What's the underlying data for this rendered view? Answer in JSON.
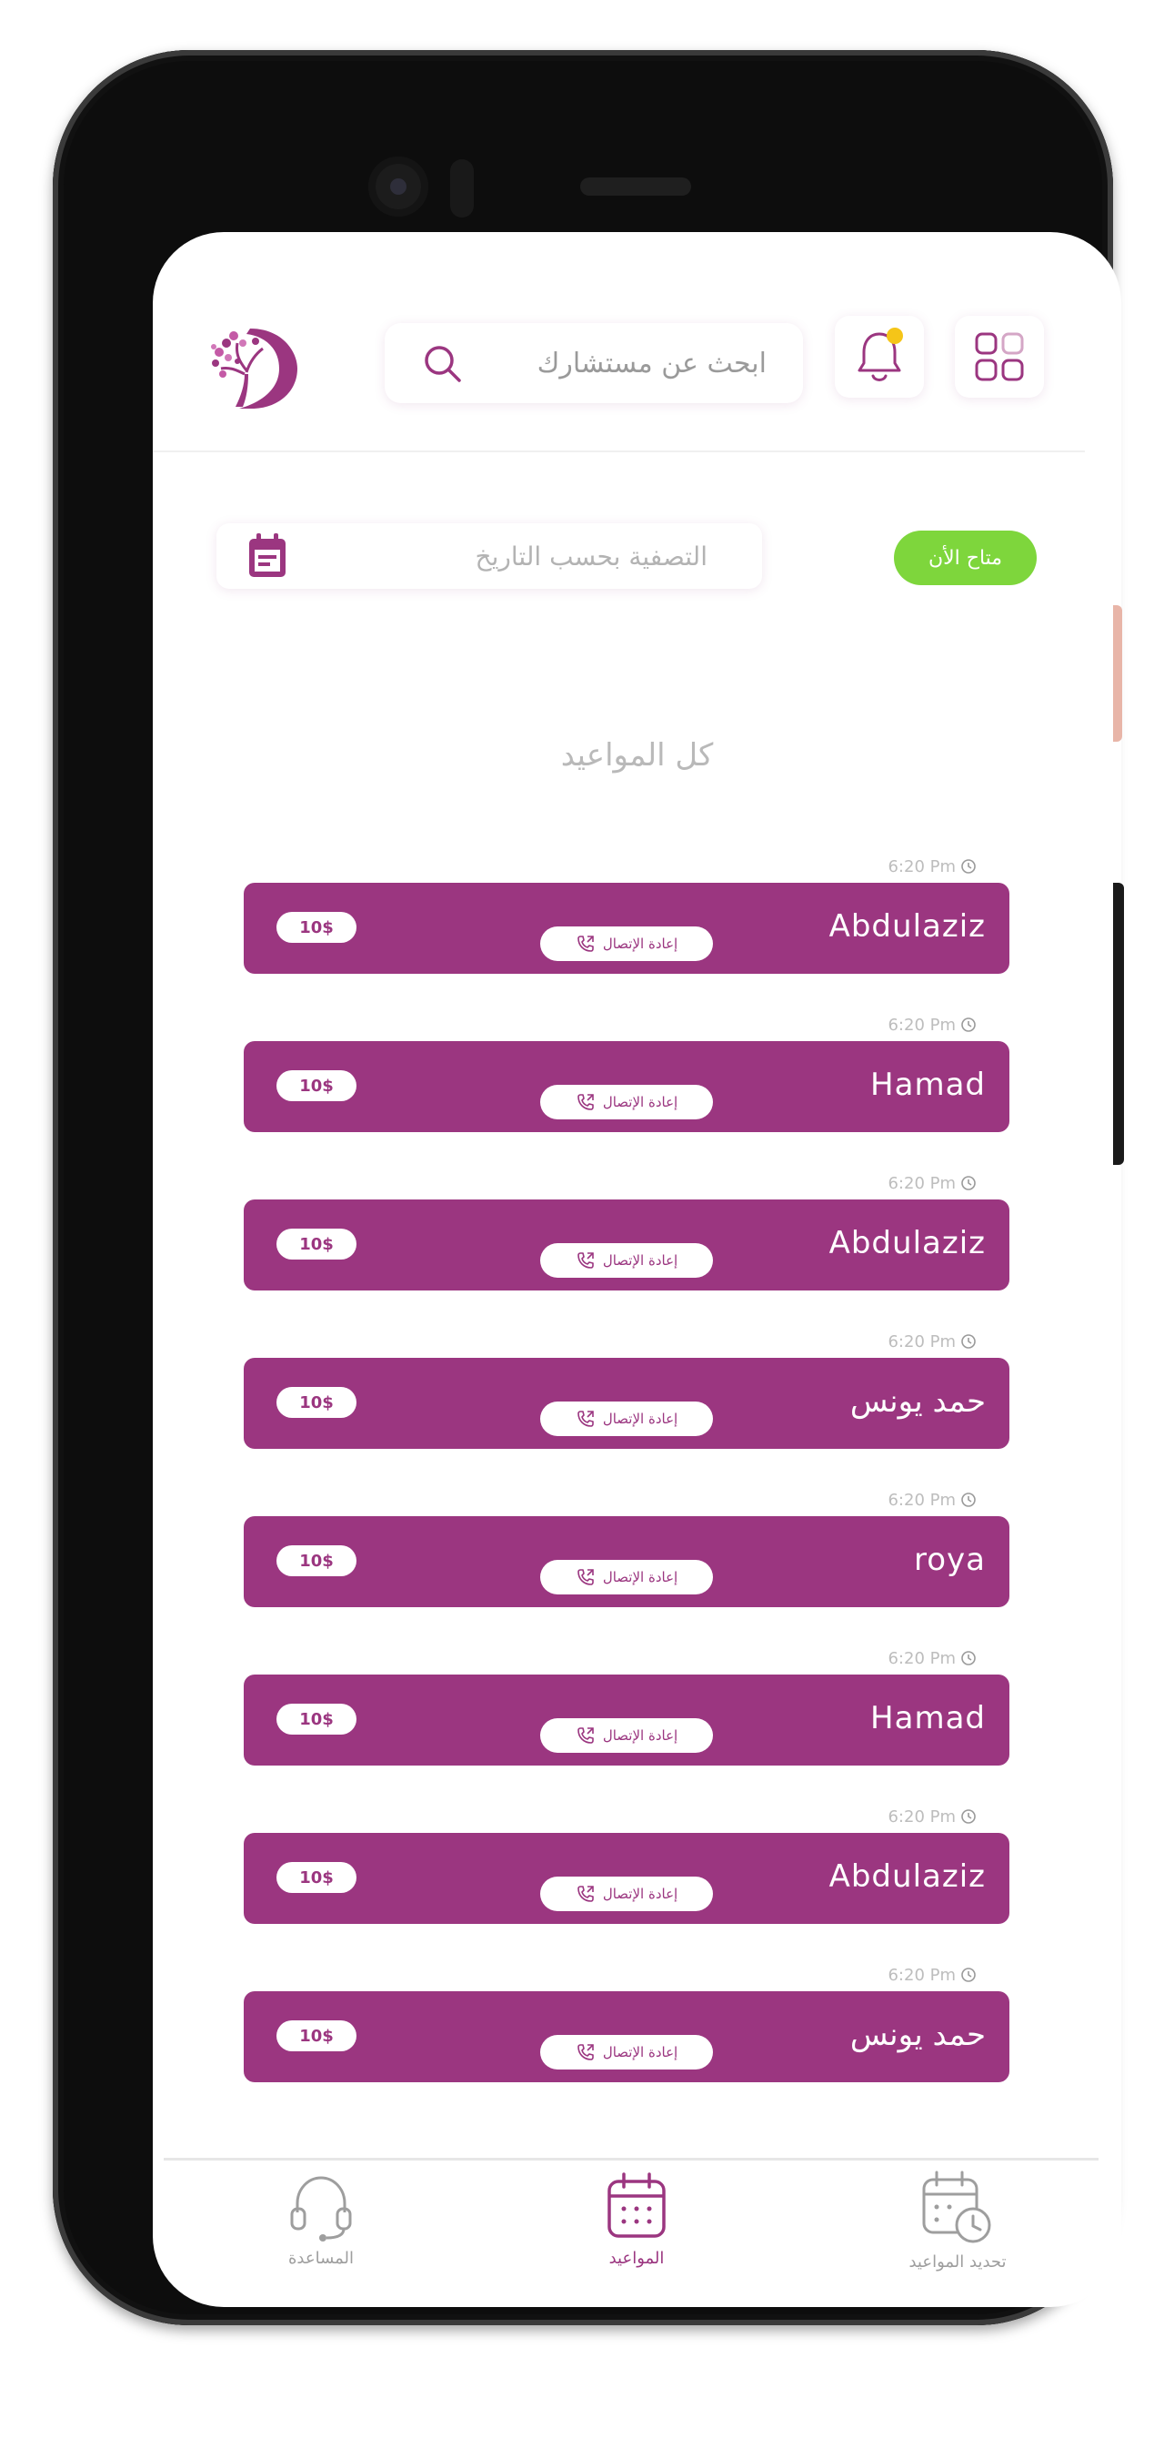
{
  "header": {
    "search_placeholder": "ابحث عن مستشارك"
  },
  "filter": {
    "placeholder": "التصفية بحسب التاريخ",
    "available_label": "متاح الأن"
  },
  "section_title": "كل المواعيد",
  "appointments": [
    {
      "name": "Abdulaziz",
      "time": "6:20 Pm",
      "price": "10$",
      "recall_label": "إعادة الإتصال"
    },
    {
      "name": "Hamad",
      "time": "6:20 Pm",
      "price": "10$",
      "recall_label": "إعادة الإتصال"
    },
    {
      "name": "Abdulaziz",
      "time": "6:20 Pm",
      "price": "10$",
      "recall_label": "إعادة الإتصال"
    },
    {
      "name": "حمد يونس",
      "time": "6:20 Pm",
      "price": "10$",
      "recall_label": "إعادة الإتصال"
    },
    {
      "name": "roya",
      "time": "6:20 Pm",
      "price": "10$",
      "recall_label": "إعادة الإتصال"
    },
    {
      "name": "Hamad",
      "time": "6:20 Pm",
      "price": "10$",
      "recall_label": "إعادة الإتصال"
    },
    {
      "name": "Abdulaziz",
      "time": "6:20 Pm",
      "price": "10$",
      "recall_label": "إعادة الإتصال"
    },
    {
      "name": "حمد يونس",
      "time": "6:20 Pm",
      "price": "10$",
      "recall_label": "إعادة الإتصال"
    }
  ],
  "bottom_nav": {
    "help_label": "المساعدة",
    "appointments_label": "المواعيد",
    "schedule_label": "تحديد المواعيد",
    "active": "appointments"
  },
  "colors": {
    "primary": "#9b3680",
    "available_green": "#7ed63c",
    "notification_dot": "#f5c518"
  },
  "icons": [
    "logo-icon",
    "search-icon",
    "bell-icon",
    "grid-menu-icon",
    "calendar-icon",
    "clock-icon",
    "phone-recall-icon",
    "headset-icon",
    "calendar-clock-icon"
  ]
}
